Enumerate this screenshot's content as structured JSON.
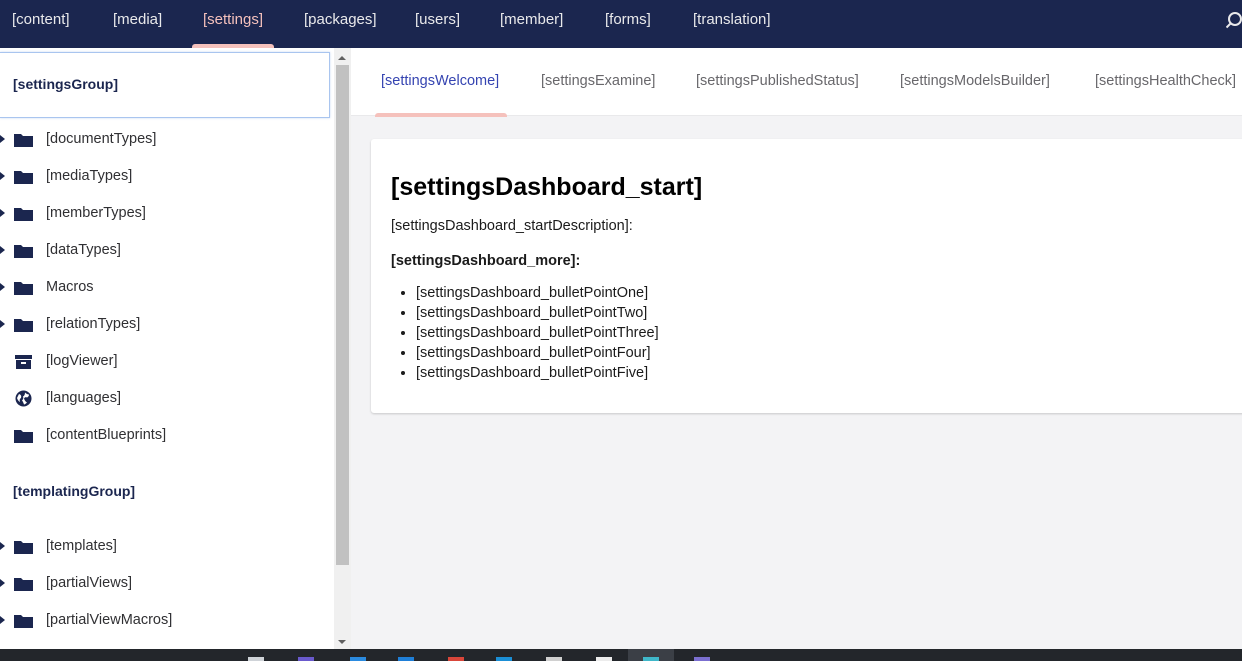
{
  "topnav": {
    "items": [
      {
        "label": "[content]"
      },
      {
        "label": "[media]"
      },
      {
        "label": "[settings]",
        "active": true
      },
      {
        "label": "[packages]"
      },
      {
        "label": "[users]"
      },
      {
        "label": "[member]"
      },
      {
        "label": "[forms]"
      },
      {
        "label": "[translation]"
      }
    ],
    "search_icon": "search-icon"
  },
  "sidebar": {
    "settings_group": {
      "title": "[settingsGroup]",
      "items": [
        {
          "label": "[documentTypes]",
          "icon": "folder-icon",
          "expandable": true
        },
        {
          "label": "[mediaTypes]",
          "icon": "folder-icon",
          "expandable": true
        },
        {
          "label": "[memberTypes]",
          "icon": "folder-icon",
          "expandable": true
        },
        {
          "label": "[dataTypes]",
          "icon": "folder-icon",
          "expandable": true
        },
        {
          "label": "Macros",
          "icon": "folder-icon",
          "expandable": true
        },
        {
          "label": "[relationTypes]",
          "icon": "folder-icon",
          "expandable": true
        },
        {
          "label": "[logViewer]",
          "icon": "archive-icon",
          "expandable": false
        },
        {
          "label": "[languages]",
          "icon": "globe-icon",
          "expandable": false
        },
        {
          "label": "[contentBlueprints]",
          "icon": "folder-icon",
          "expandable": false
        }
      ]
    },
    "templating_group": {
      "title": "[templatingGroup]",
      "items": [
        {
          "label": "[templates]",
          "icon": "folder-icon",
          "expandable": true
        },
        {
          "label": "[partialViews]",
          "icon": "folder-icon",
          "expandable": true
        },
        {
          "label": "[partialViewMacros]",
          "icon": "folder-icon",
          "expandable": true
        }
      ]
    }
  },
  "main": {
    "tabs": [
      {
        "label": "[settingsWelcome]",
        "active": true
      },
      {
        "label": "[settingsExamine]"
      },
      {
        "label": "[settingsPublishedStatus]"
      },
      {
        "label": "[settingsModelsBuilder]"
      },
      {
        "label": "[settingsHealthCheck]"
      }
    ],
    "dashboard": {
      "title": "[settingsDashboard_start]",
      "description": "[settingsDashboard_startDescription]:",
      "more": "[settingsDashboard_more]:",
      "bullets": [
        "[settingsDashboard_bulletPointOne]",
        "[settingsDashboard_bulletPointTwo]",
        "[settingsDashboard_bulletPointThree]",
        "[settingsDashboard_bulletPointFour]",
        "[settingsDashboard_bulletPointFive]"
      ]
    }
  },
  "colors": {
    "nav_bg": "#1b264f",
    "nav_active": "#f5c1bc",
    "tab_active": "#3544b1",
    "icon": "#1b264f"
  }
}
